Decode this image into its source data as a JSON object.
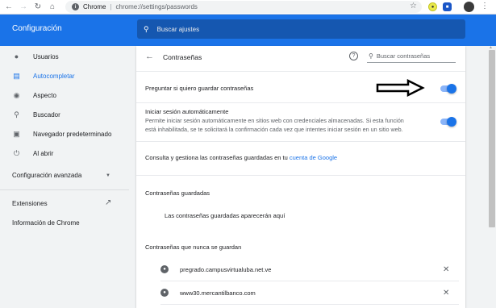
{
  "browser": {
    "back_icon": "back-arrow-icon",
    "site_label": "Chrome",
    "separator": "|",
    "url": "chrome://settings/passwords"
  },
  "header": {
    "title": "Configuración",
    "search_placeholder": "Buscar ajustes"
  },
  "sidebar": {
    "items": [
      {
        "label": "Usuarios",
        "icon": "person-icon"
      },
      {
        "label": "Autocompletar",
        "icon": "clipboard-icon"
      },
      {
        "label": "Aspecto",
        "icon": "palette-icon"
      },
      {
        "label": "Buscador",
        "icon": "search-icon"
      },
      {
        "label": "Navegador predeterminado",
        "icon": "browser-icon"
      },
      {
        "label": "Al abrir",
        "icon": "power-icon"
      }
    ],
    "advanced": "Configuración avanzada",
    "extensions": "Extensiones",
    "about": "Información de Chrome"
  },
  "passwords": {
    "title": "Contraseñas",
    "search_placeholder": "Buscar contraseñas",
    "offer_save": "Preguntar si quiero guardar contraseñas",
    "offer_save_on": true,
    "autosignin_title": "Iniciar sesión automáticamente",
    "autosignin_desc": "Permite iniciar sesión automáticamente en sitios web con credenciales almacenadas. Si esta función está inhabilitada, se te solicitará la confirmación cada vez que intentes iniciar sesión en un sitio web.",
    "autosignin_on": true,
    "manage_prefix": "Consulta y gestiona las contraseñas guardadas en tu ",
    "manage_link": "cuenta de Google",
    "saved_header": "Contraseñas guardadas",
    "saved_empty": "Las contraseñas guardadas aparecerán aquí",
    "never_header": "Contraseñas que nunca se guardan",
    "never_sites": [
      "pregrado.campusvirtualuba.net.ve",
      "www30.mercantilbanco.com"
    ]
  },
  "colors": {
    "accent": "#1a73e8",
    "header_bg": "#1a73e8",
    "search_bg": "#1557b0"
  }
}
